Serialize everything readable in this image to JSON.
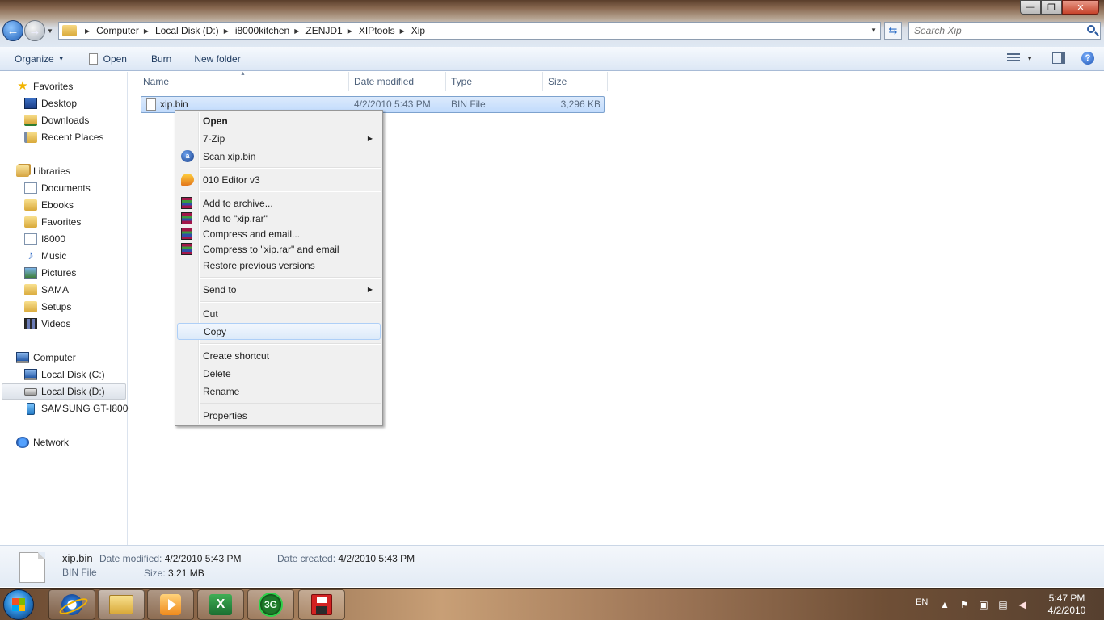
{
  "window": {
    "controls": {
      "minimize": "—",
      "maximize": "❐",
      "close": "✕"
    }
  },
  "address": {
    "breadcrumbs": [
      "Computer",
      "Local Disk (D:)",
      "i8000kitchen",
      "ZENJD1",
      "XIPtools",
      "Xip"
    ],
    "search_placeholder": "Search Xip"
  },
  "toolbar": {
    "organize": "Organize",
    "open": "Open",
    "burn": "Burn",
    "new_folder": "New folder"
  },
  "nav": {
    "favorites": "Favorites",
    "desktop": "Desktop",
    "downloads": "Downloads",
    "recent_places": "Recent Places",
    "libraries": "Libraries",
    "documents": "Documents",
    "ebooks": "Ebooks",
    "lib_favorites": "Favorites",
    "i8000": "I8000",
    "music": "Music",
    "pictures": "Pictures",
    "sama": "SAMA",
    "setups": "Setups",
    "videos": "Videos",
    "computer": "Computer",
    "local_c": "Local Disk (C:)",
    "local_d": "Local Disk (D:)",
    "samsung": "SAMSUNG GT-I8000",
    "network": "Network"
  },
  "columns": {
    "name": "Name",
    "date_modified": "Date modified",
    "type": "Type",
    "size": "Size"
  },
  "files": [
    {
      "name": "xip.bin",
      "date": "4/2/2010 5:43 PM",
      "type": "BIN File",
      "size": "3,296 KB"
    }
  ],
  "context_menu": {
    "open": "Open",
    "seven_zip": "7-Zip",
    "scan": "Scan xip.bin",
    "editor": "010 Editor v3",
    "add_archive": "Add to archive...",
    "add_rar": "Add to \"xip.rar\"",
    "compress_email": "Compress and email...",
    "compress_rar_email": "Compress to \"xip.rar\" and email",
    "restore": "Restore previous versions",
    "send_to": "Send to",
    "cut": "Cut",
    "copy": "Copy",
    "create_shortcut": "Create shortcut",
    "delete": "Delete",
    "rename": "Rename",
    "properties": "Properties"
  },
  "details": {
    "name": "xip.bin",
    "type": "BIN File",
    "date_modified_label": "Date modified:",
    "date_modified": "4/2/2010 5:43 PM",
    "date_created_label": "Date created:",
    "date_created": "4/2/2010 5:43 PM",
    "size_label": "Size:",
    "size": "3.21 MB"
  },
  "taskbar": {
    "excel_letter": "X",
    "three_g": "3G",
    "language": "EN",
    "time": "5:47 PM",
    "date": "4/2/2010"
  }
}
